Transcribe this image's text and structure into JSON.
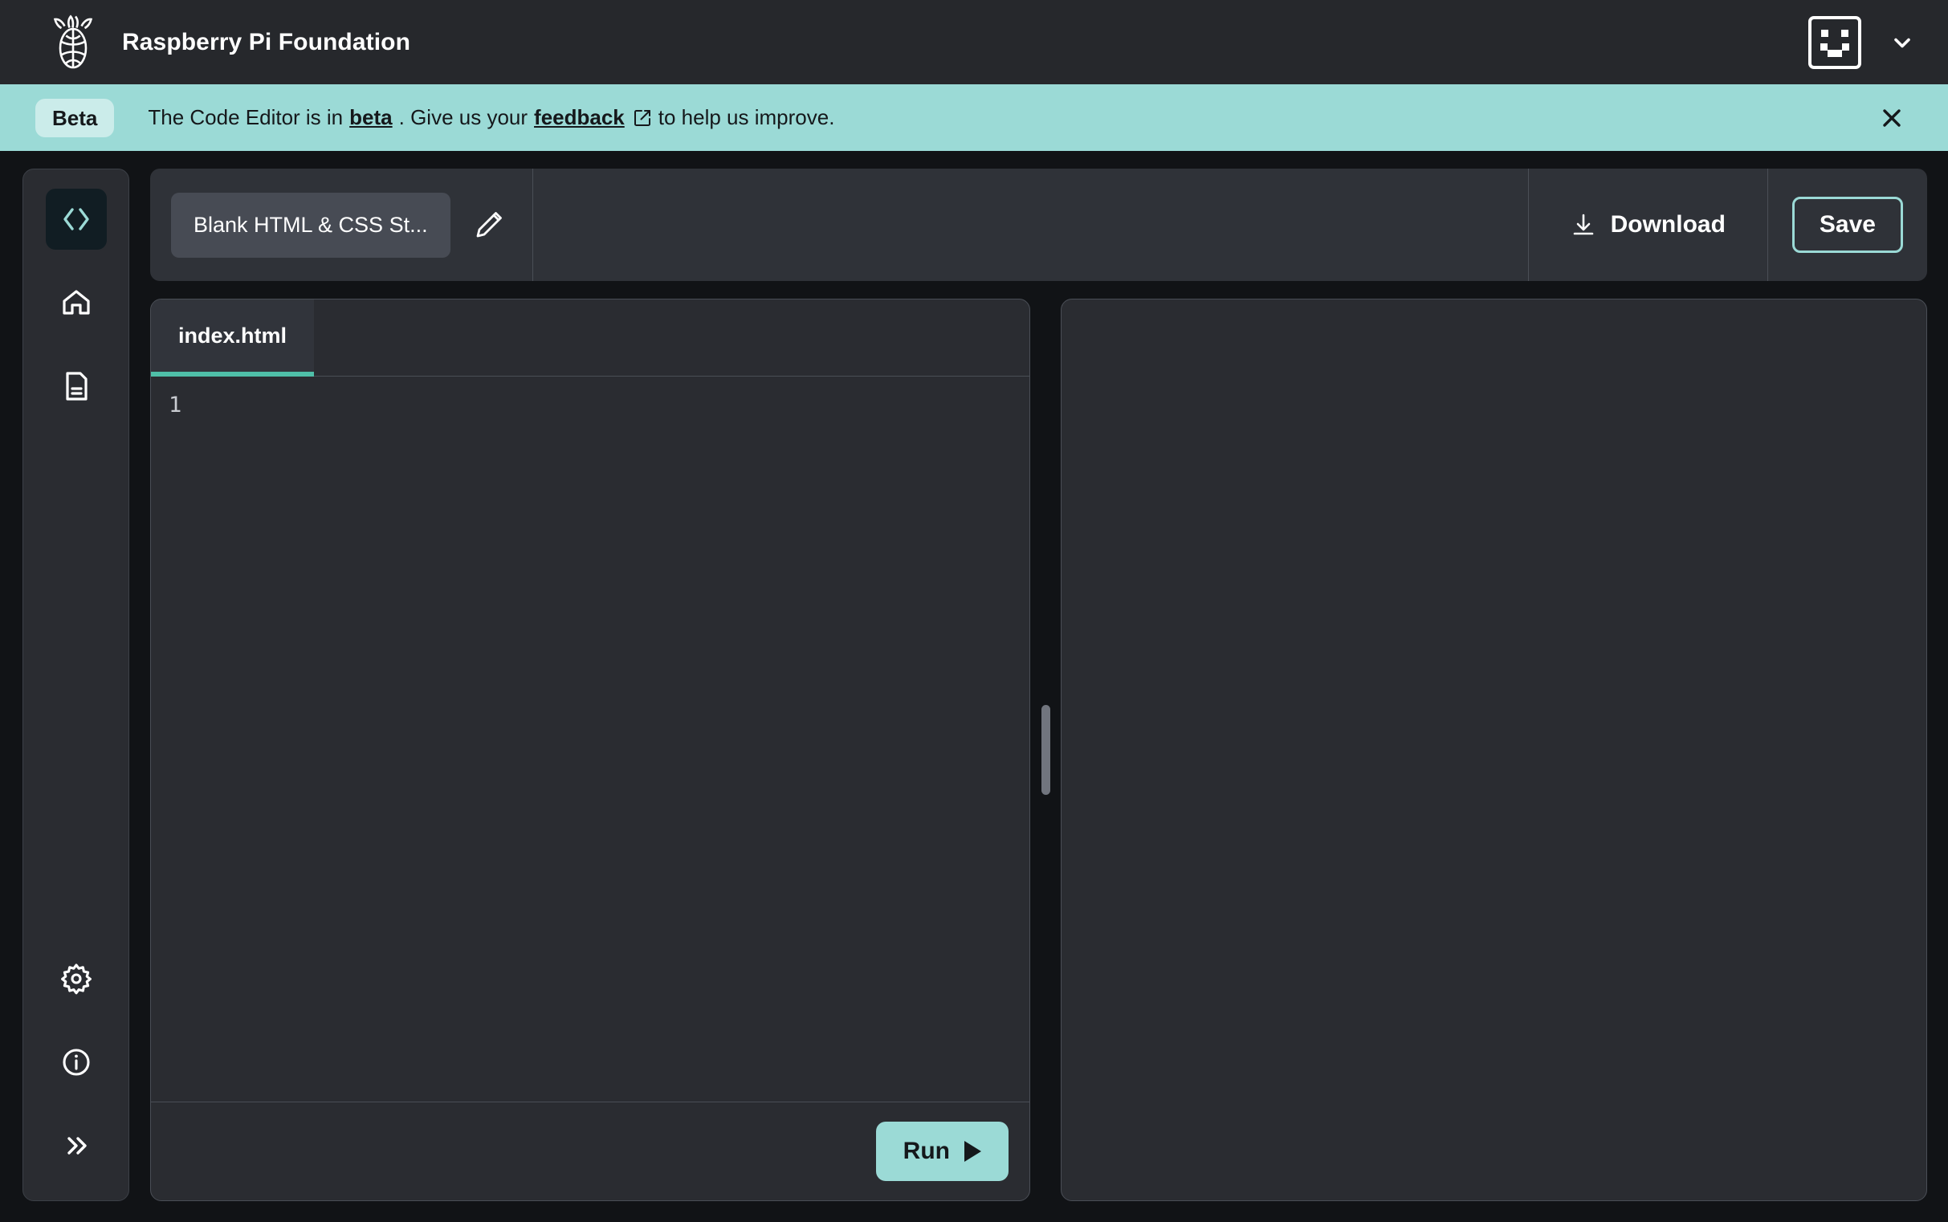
{
  "header": {
    "brand_title": "Raspberry Pi Foundation",
    "logo_icon": "raspberry-pi-logo",
    "avatar_icon": "pixel-smiley-avatar",
    "chevron_icon": "chevron-down-icon"
  },
  "banner": {
    "pill_label": "Beta",
    "text_before": "The Code Editor is in",
    "text_emphasis": "beta",
    "text_middle": ". Give us your",
    "link_label": "feedback",
    "external_icon": "external-link-icon",
    "text_after": "to help us improve.",
    "close_icon": "close-icon",
    "background_color": "#9BDAD6",
    "pill_background_color": "#CBECEA"
  },
  "sidebar": {
    "items": [
      {
        "name": "code-editor",
        "icon": "code-brackets-icon",
        "active": true
      },
      {
        "name": "home",
        "icon": "home-icon",
        "active": false
      },
      {
        "name": "file",
        "icon": "document-icon",
        "active": false
      }
    ],
    "bottom_items": [
      {
        "name": "settings",
        "icon": "gear-icon",
        "active": false
      },
      {
        "name": "info",
        "icon": "info-circle-icon",
        "active": false
      },
      {
        "name": "expand",
        "icon": "double-chevron-right-icon",
        "active": false
      }
    ],
    "active_icon_color": "#9BDAD6",
    "active_background_color": "#111D23"
  },
  "toolbar": {
    "project_name": "Blank HTML & CSS St...",
    "project_name_placeholder": "Project name",
    "edit_icon": "pencil-icon",
    "download_label": "Download",
    "download_icon": "download-icon",
    "save_label": "Save",
    "save_border_color": "#9BDAD6"
  },
  "editor": {
    "tabs": [
      {
        "label": "index.html",
        "active": true
      }
    ],
    "active_tab_underline_color": "#4FBFA8",
    "line_numbers": [
      "1"
    ],
    "code_lines": [
      ""
    ],
    "run_label": "Run",
    "run_icon": "play-triangle-icon",
    "run_background_color": "#9BDAD6"
  },
  "splitter": {
    "name": "pane-resize-handle",
    "color": "#71757E"
  },
  "preview": {
    "content": "",
    "background_color": "#2A2C31"
  }
}
